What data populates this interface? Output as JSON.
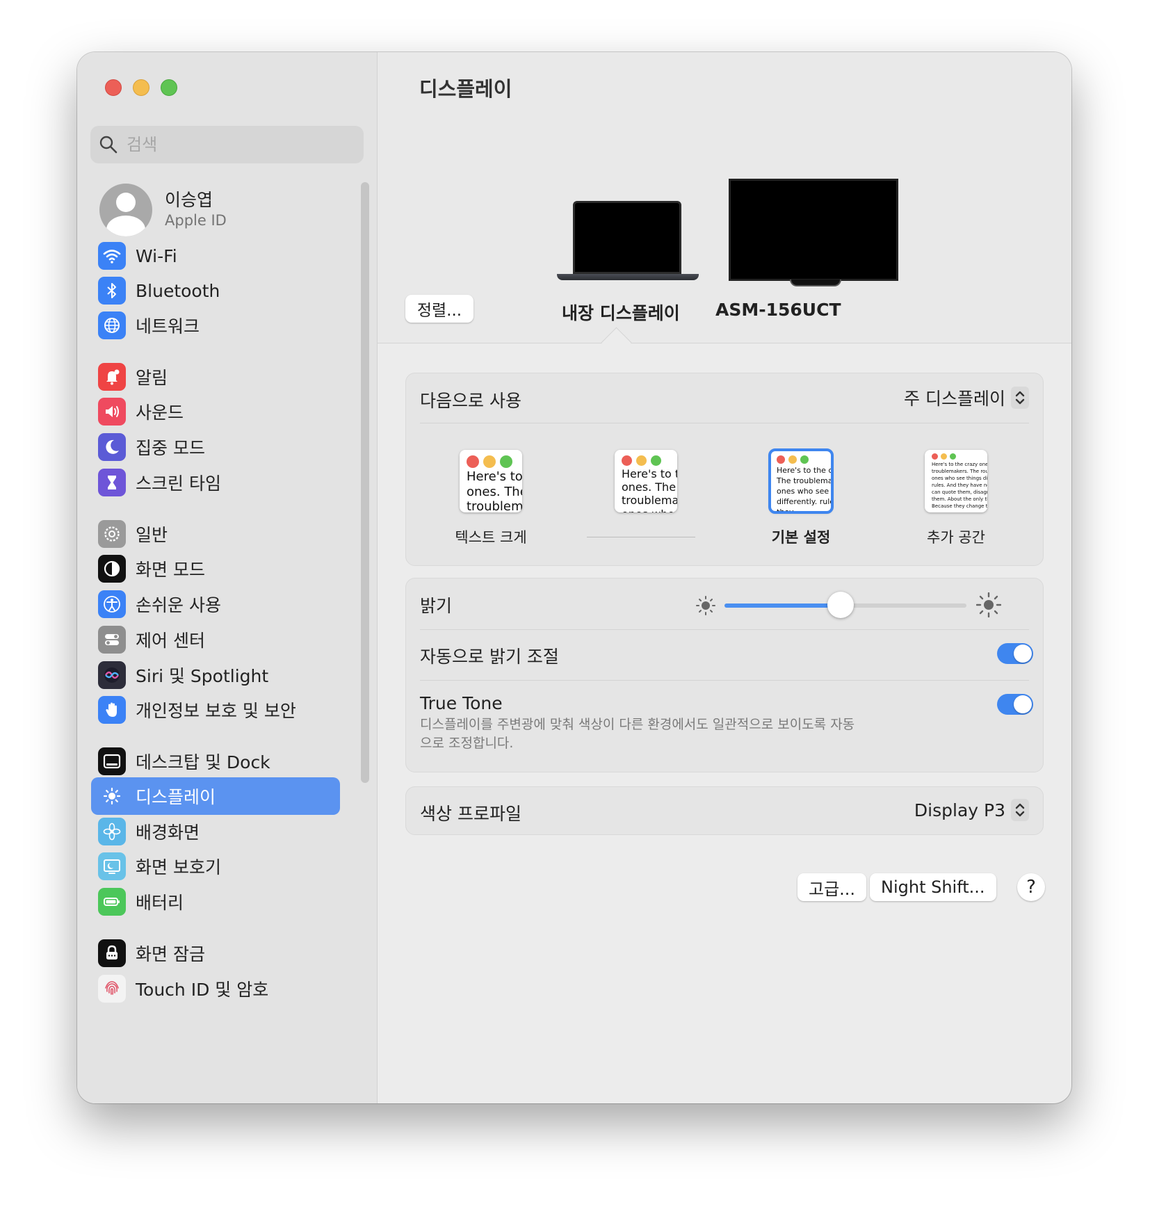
{
  "search": {
    "placeholder": "검색"
  },
  "profile": {
    "name": "이승엽",
    "subtitle": "Apple ID"
  },
  "sidebar": {
    "items": [
      {
        "label": "Wi-Fi",
        "icon": "wifi-icon",
        "color": "#3b82f6"
      },
      {
        "label": "Bluetooth",
        "icon": "bluetooth-icon",
        "color": "#3b82f6"
      },
      {
        "label": "네트워크",
        "icon": "globe-icon",
        "color": "#3b82f6"
      },
      {
        "label": "알림",
        "icon": "bell-icon",
        "color": "#ef4444"
      },
      {
        "label": "사운드",
        "icon": "speaker-icon",
        "color": "#ef4a5f"
      },
      {
        "label": "집중 모드",
        "icon": "moon-icon",
        "color": "#5b5bd6"
      },
      {
        "label": "스크린 타임",
        "icon": "hourglass-icon",
        "color": "#6e55d8"
      },
      {
        "label": "일반",
        "icon": "gear-icon",
        "color": "#9a9a9a"
      },
      {
        "label": "화면 모드",
        "icon": "appearance-icon",
        "color": "#111111"
      },
      {
        "label": "손쉬운 사용",
        "icon": "accessibility-icon",
        "color": "#3b82f6"
      },
      {
        "label": "제어 센터",
        "icon": "switches-icon",
        "color": "#8e8e8e"
      },
      {
        "label": "Siri 및 Spotlight",
        "icon": "siri-icon",
        "color": "#2d2d3a"
      },
      {
        "label": "개인정보 보호 및 보안",
        "icon": "hand-icon",
        "color": "#3b82f6"
      },
      {
        "label": "데스크탑 및 Dock",
        "icon": "dock-icon",
        "color": "#111111"
      },
      {
        "label": "디스플레이",
        "icon": "sun-icon",
        "color": "#3b82f6",
        "selected": true
      },
      {
        "label": "배경화면",
        "icon": "flower-icon",
        "color": "#5ab6e8"
      },
      {
        "label": "화면 보호기",
        "icon": "screensaver-icon",
        "color": "#69c2e8"
      },
      {
        "label": "배터리",
        "icon": "battery-icon",
        "color": "#4cc75a"
      },
      {
        "label": "화면 잠금",
        "icon": "lock-icon",
        "color": "#111111"
      },
      {
        "label": "Touch ID 및 암호",
        "icon": "fingerprint-icon",
        "color": "#f3f3f3"
      }
    ]
  },
  "main": {
    "title": "디스플레이",
    "arrange_label": "정렬...",
    "displays": [
      {
        "label": "내장 디스플레이",
        "selected": true
      },
      {
        "label": "ASM-156UCT",
        "selected": false
      }
    ],
    "use_as": {
      "label": "다음으로 사용",
      "value": "주 디스플레이"
    },
    "resolution": {
      "options": [
        {
          "caption": "텍스트 크게",
          "sample": "Here's to the crazy ones. The troublemakers. The"
        },
        {
          "caption": "",
          "sample": "Here's to the crazy ones. The troublemakers. The ones who"
        },
        {
          "caption": "기본 설정",
          "sample": "Here's to the crazy ones. The troublemakers. The ones who see things differently. rules. And they"
        },
        {
          "caption": "추가 공간",
          "sample": "Here's to the crazy ones. The troublemakers. The round pegs ones who see things differently. rules. And they have no respect can quote them, disagree with them. About the only thing Because they change things."
        }
      ],
      "selected_index": 2
    },
    "brightness": {
      "label": "밝기",
      "value": 0.48
    },
    "auto_brightness": {
      "label": "자동으로 밝기 조절",
      "on": true
    },
    "true_tone": {
      "label": "True Tone",
      "description": "디스플레이를 주변광에 맞춰 색상이 다른 환경에서도 일관적으로 보이도록 자동으로 조정합니다.",
      "on": true
    },
    "color_profile": {
      "label": "색상 프로파일",
      "value": "Display P3"
    },
    "advanced_label": "고급...",
    "night_shift_label": "Night Shift...",
    "help_label": "?"
  },
  "colors": {
    "accent": "#3f86ef",
    "selection": "#5b93f0"
  }
}
